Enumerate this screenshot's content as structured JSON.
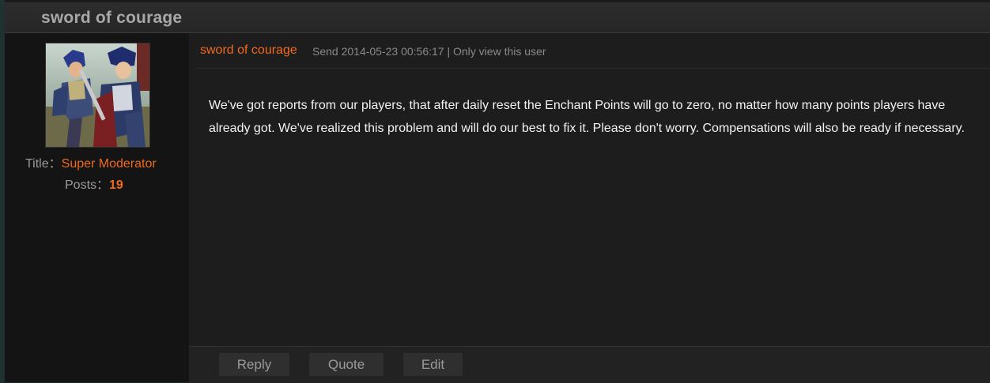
{
  "thread": {
    "title": "sword of courage"
  },
  "user": {
    "avatar_alt": "avatar",
    "title_label": "Title：",
    "title_value": "Super Moderator",
    "posts_label": "Posts：",
    "posts_value": "19"
  },
  "post": {
    "author": "sword of courage",
    "info": "Send 2014-05-23 00:56:17 | Only view this user",
    "body": "We've got reports from our players, that after daily reset the Enchant Points will go to zero, no matter how many points players have already got. We've realized this problem and will do our best to fix it. Please don't worry. Compensations will also be ready if necessary."
  },
  "actions": {
    "reply": "Reply",
    "quote": "Quote",
    "edit": "Edit"
  },
  "colors": {
    "accent": "#f06a1c",
    "panel": "#1a1a1a",
    "text": "#f2f2f2"
  }
}
